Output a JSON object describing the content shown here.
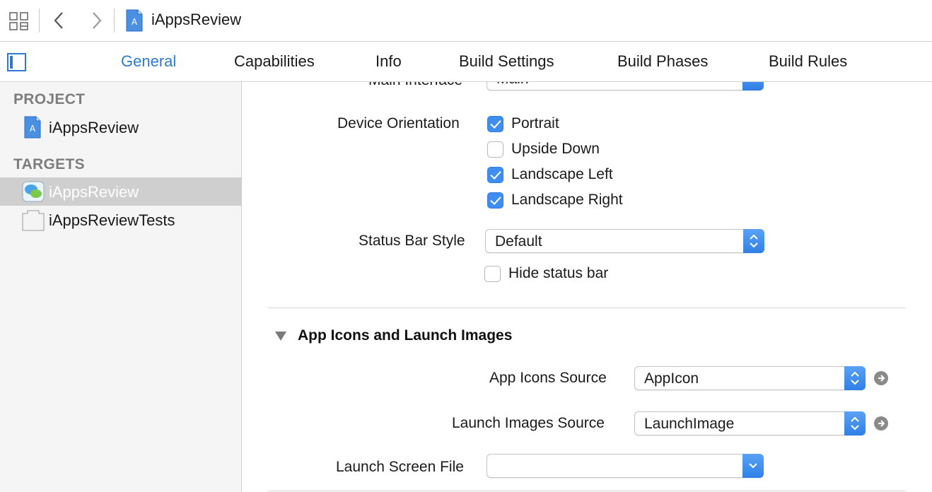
{
  "window": {
    "project_name": "iAppsReview"
  },
  "tabs": [
    {
      "label": "General",
      "active": true
    },
    {
      "label": "Capabilities",
      "active": false
    },
    {
      "label": "Info",
      "active": false
    },
    {
      "label": "Build Settings",
      "active": false
    },
    {
      "label": "Build Phases",
      "active": false
    },
    {
      "label": "Build Rules",
      "active": false
    }
  ],
  "sidebar": {
    "project_header": "PROJECT",
    "project_item": "iAppsReview",
    "targets_header": "TARGETS",
    "targets": [
      {
        "label": "iAppsReview",
        "selected": true
      },
      {
        "label": "iAppsReviewTests",
        "selected": false
      }
    ]
  },
  "deployment": {
    "main_interface_label": "Main Interface",
    "main_interface_value": "Main",
    "orientation_label": "Device Orientation",
    "orientations": [
      {
        "label": "Portrait",
        "checked": true
      },
      {
        "label": "Upside Down",
        "checked": false
      },
      {
        "label": "Landscape Left",
        "checked": true
      },
      {
        "label": "Landscape Right",
        "checked": true
      }
    ],
    "status_bar_label": "Status Bar Style",
    "status_bar_value": "Default",
    "hide_status_bar_label": "Hide status bar",
    "hide_status_bar_checked": false
  },
  "app_icons": {
    "section_title": "App Icons and Launch Images",
    "icons_source_label": "App Icons Source",
    "icons_source_value": "AppIcon",
    "launch_images_label": "Launch Images Source",
    "launch_images_value": "LaunchImage",
    "launch_screen_label": "Launch Screen File",
    "launch_screen_value": ""
  },
  "colors": {
    "accent": "#2f7ad0",
    "checkbox_on": "#3d8ef0",
    "selected_row": "#cfcfcf"
  }
}
